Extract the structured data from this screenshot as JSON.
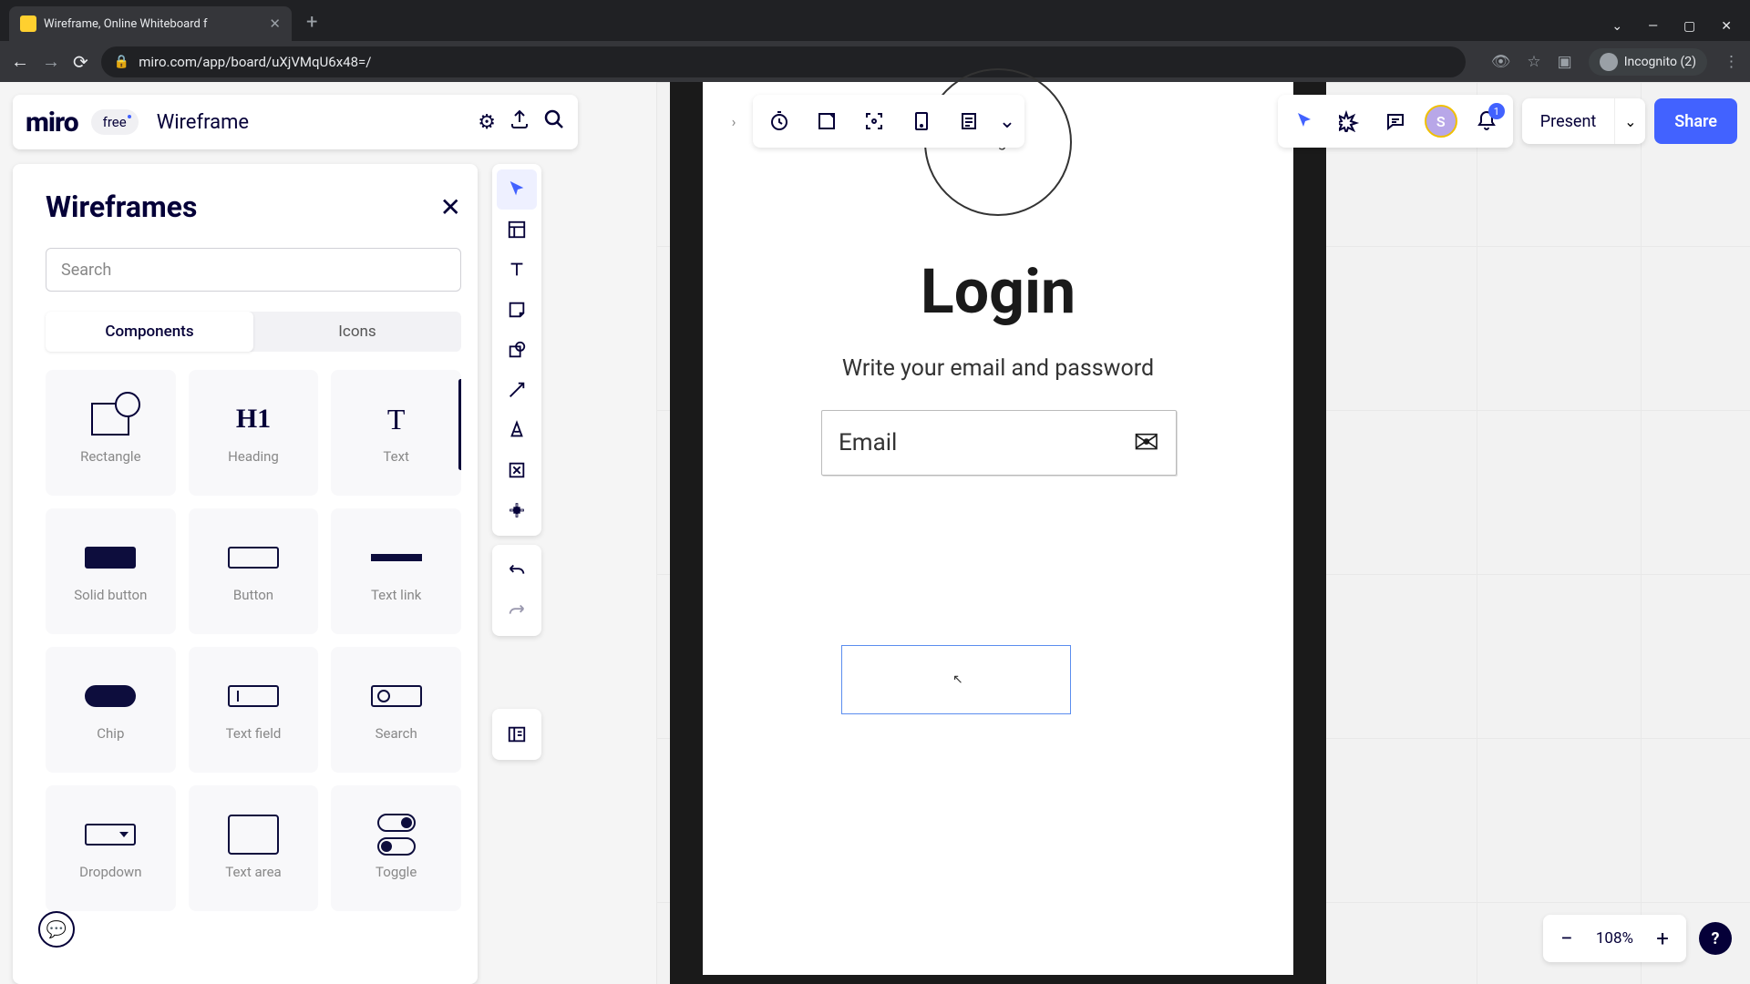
{
  "browser": {
    "tab_title": "Wireframe, Online Whiteboard f",
    "url": "miro.com/app/board/uXjVMqU6x48=/",
    "incognito_label": "Incognito (2)"
  },
  "header": {
    "logo": "miro",
    "plan": "free",
    "board_name": "Wireframe"
  },
  "panel": {
    "title": "Wireframes",
    "search_placeholder": "Search",
    "tabs": {
      "components": "Components",
      "icons": "Icons"
    },
    "items": [
      {
        "label": "Rectangle"
      },
      {
        "label": "Heading"
      },
      {
        "label": "Text"
      },
      {
        "label": "Solid button"
      },
      {
        "label": "Button"
      },
      {
        "label": "Text link"
      },
      {
        "label": "Chip"
      },
      {
        "label": "Text field"
      },
      {
        "label": "Search"
      },
      {
        "label": "Dropdown"
      },
      {
        "label": "Text area"
      },
      {
        "label": "Toggle"
      }
    ]
  },
  "canvas": {
    "logo_text": "Logo",
    "title": "Login",
    "subtitle": "Write your email and password",
    "email_label": "Email"
  },
  "collab": {
    "avatar_initial": "S",
    "notif_count": "1",
    "present": "Present",
    "share": "Share"
  },
  "zoom": {
    "value": "108%"
  }
}
